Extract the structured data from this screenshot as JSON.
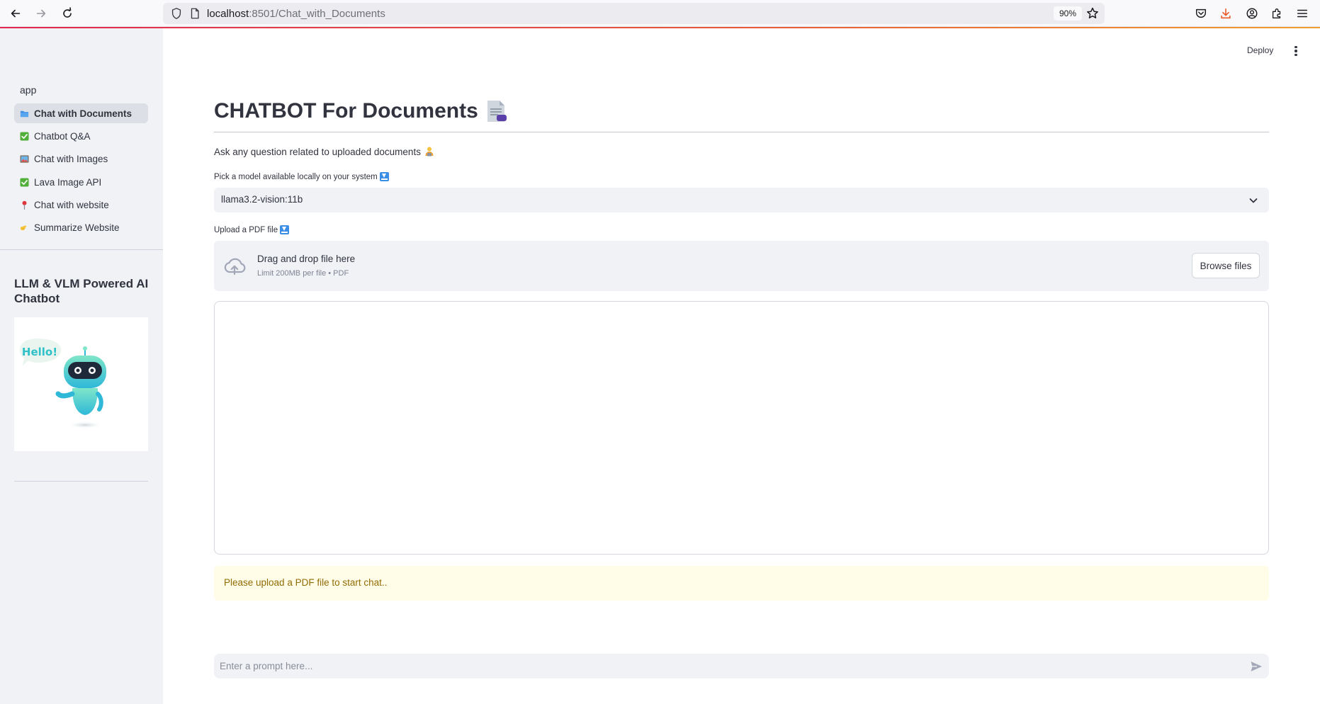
{
  "browser": {
    "url_host": "localhost",
    "url_path": ":8501/Chat_with_Documents",
    "zoom": "90%"
  },
  "sidebar": {
    "app_label": "app",
    "items": [
      {
        "label": "Chat with Documents",
        "icon": "folder-icon",
        "active": true
      },
      {
        "label": "Chatbot Q&A",
        "icon": "check-box-icon",
        "active": false
      },
      {
        "label": "Chat with Images",
        "icon": "picture-icon",
        "active": false
      },
      {
        "label": "Lava Image API",
        "icon": "check-box-icon",
        "active": false
      },
      {
        "label": "Chat with website",
        "icon": "pushpin-icon",
        "active": false
      },
      {
        "label": "Summarize Website",
        "icon": "pointing-hand-icon",
        "active": false
      }
    ],
    "heading": "LLM & VLM Powered AI Chatbot",
    "image_bubble_text": "Hello!"
  },
  "header": {
    "deploy_label": "Deploy"
  },
  "main": {
    "title": "CHATBOT For Documents",
    "subtitle": "Ask any question related to uploaded documents",
    "model_label": "Pick a model available locally on your system",
    "model_value": "llama3.2-vision:11b",
    "upload_label": "Upload a PDF file",
    "upload_title": "Drag and drop file here",
    "upload_limit": "Limit 200MB per file • PDF",
    "browse_label": "Browse files",
    "warning": "Please upload a PDF file to start chat..",
    "prompt_placeholder": "Enter a prompt here..."
  },
  "colors": {
    "sidebar_bg": "#f0f2f6",
    "active_item_bg": "#dcdfe6",
    "warning_bg": "#fffce7",
    "warning_text": "#926c05",
    "accent_blue": "#3b8ee6"
  }
}
